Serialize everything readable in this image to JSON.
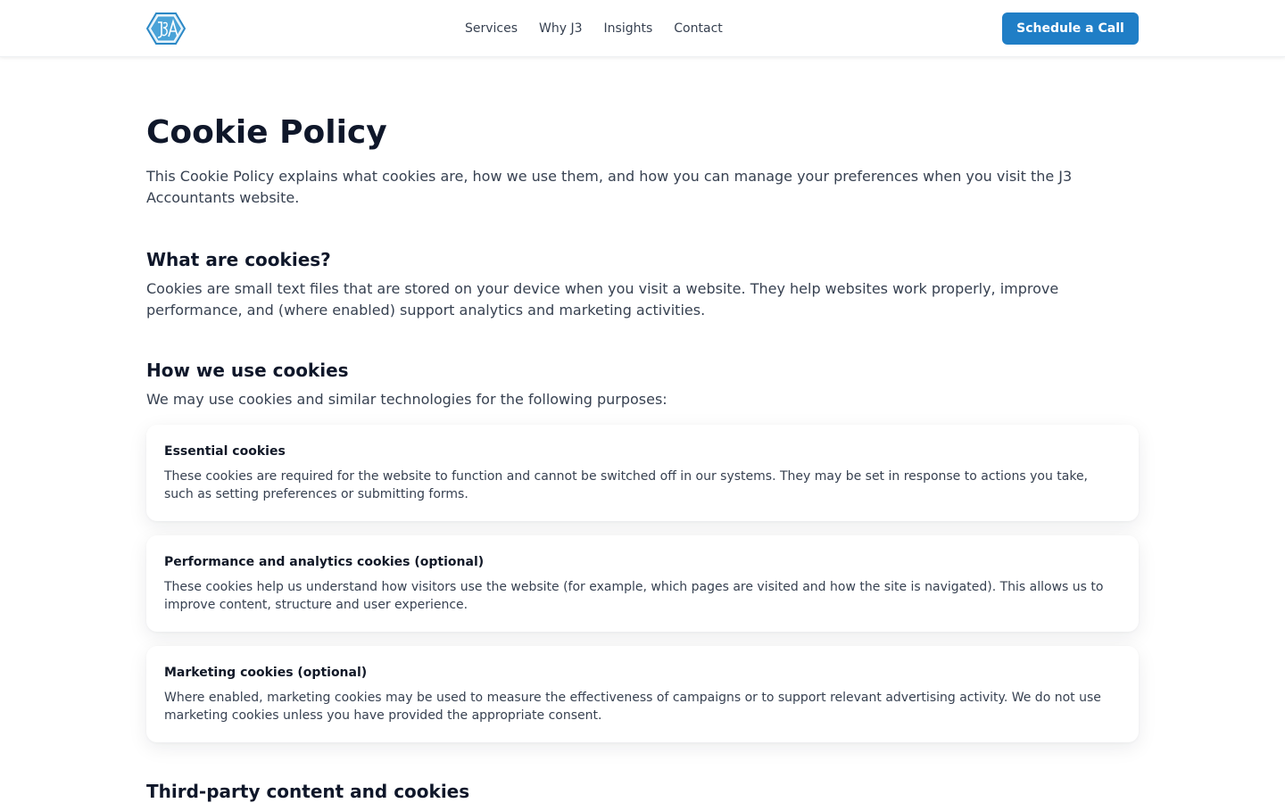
{
  "header": {
    "logo_alt": "J3A logo",
    "nav": [
      "Services",
      "Why J3",
      "Insights",
      "Contact"
    ],
    "cta_label": "Schedule a Call"
  },
  "page": {
    "title": "Cookie Policy",
    "intro": "This Cookie Policy explains what cookies are, how we use them, and how you can manage your preferences when you visit the J3 Accountants website."
  },
  "sections": [
    {
      "heading": "What are cookies?",
      "text": "Cookies are small text files that are stored on your device when you visit a website. They help websites work properly, improve performance, and (where enabled) support analytics and marketing activities."
    },
    {
      "heading": "How we use cookies",
      "text": "We may use cookies and similar technologies for the following purposes:"
    },
    {
      "heading": "Third-party content and cookies"
    }
  ],
  "cards": [
    {
      "title": "Essential cookies",
      "text": "These cookies are required for the website to function and cannot be switched off in our systems. They may be set in response to actions you take, such as setting preferences or submitting forms."
    },
    {
      "title": "Performance and analytics cookies (optional)",
      "text": "These cookies help us understand how visitors use the website (for example, which pages are visited and how the site is navigated). This allows us to improve content, structure and user experience."
    },
    {
      "title": "Marketing cookies (optional)",
      "text": "Where enabled, marketing cookies may be used to measure the effectiveness of campaigns or to support relevant advertising activity. We do not use marketing cookies unless you have provided the appropriate consent."
    }
  ],
  "colors": {
    "brand_blue": "#1f7ec6",
    "heading": "#0f172a",
    "body": "#374151"
  }
}
